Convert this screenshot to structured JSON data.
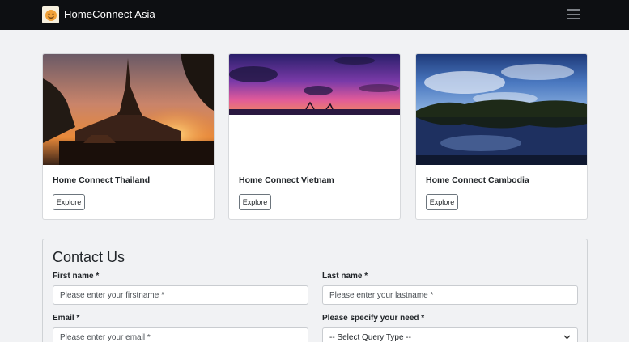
{
  "nav": {
    "brand": "HomeConnect Asia"
  },
  "cards": [
    {
      "title": "Home Connect Thailand",
      "button": "Explore"
    },
    {
      "title": "Home Connect Vietnam",
      "button": "Explore"
    },
    {
      "title": "Home Connect Cambodia",
      "button": "Explore"
    }
  ],
  "contact": {
    "title": "Contact Us",
    "first_name_label": "First name *",
    "first_name_placeholder": "Please enter your firstname *",
    "last_name_label": "Last name *",
    "last_name_placeholder": "Please enter your lastname *",
    "email_label": "Email *",
    "email_placeholder": "Please enter your email *",
    "need_label": "Please specify your need *",
    "need_selected": "-- Select Query Type --"
  }
}
